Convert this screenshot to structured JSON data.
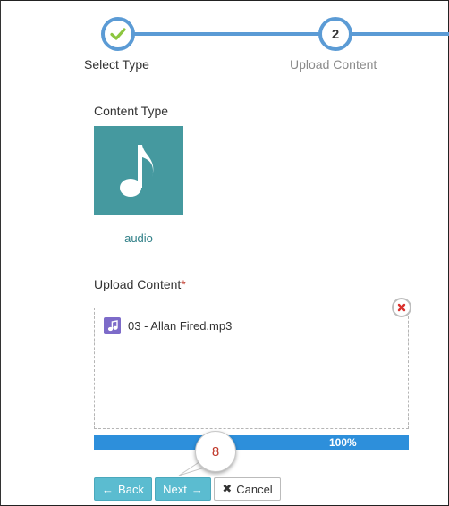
{
  "stepper": {
    "steps": [
      {
        "label": "Select Type",
        "state": "completed",
        "icon": "check-icon"
      },
      {
        "label": "Upload Content",
        "number": "2",
        "state": "current"
      }
    ],
    "colors": {
      "line": "#5b9bd5",
      "check": "#8cc63f"
    }
  },
  "content_type": {
    "label": "Content Type",
    "selected": {
      "caption": "audio",
      "icon": "music-note-icon",
      "color": "#45999f"
    }
  },
  "upload": {
    "label": "Upload Content",
    "required_mark": "*",
    "file": {
      "name": "03 - Allan Fired.mp3",
      "icon": "audio-file-icon",
      "icon_color": "#7d6bc9"
    },
    "remove_icon": "close-icon"
  },
  "progress": {
    "percent": 100,
    "text": "100%"
  },
  "annotation": {
    "number": "8"
  },
  "buttons": {
    "back": {
      "label": "Back",
      "icon": "arrow-left-icon"
    },
    "next": {
      "label": "Next",
      "icon": "arrow-right-icon"
    },
    "cancel": {
      "label": "Cancel",
      "icon": "close-icon"
    }
  }
}
